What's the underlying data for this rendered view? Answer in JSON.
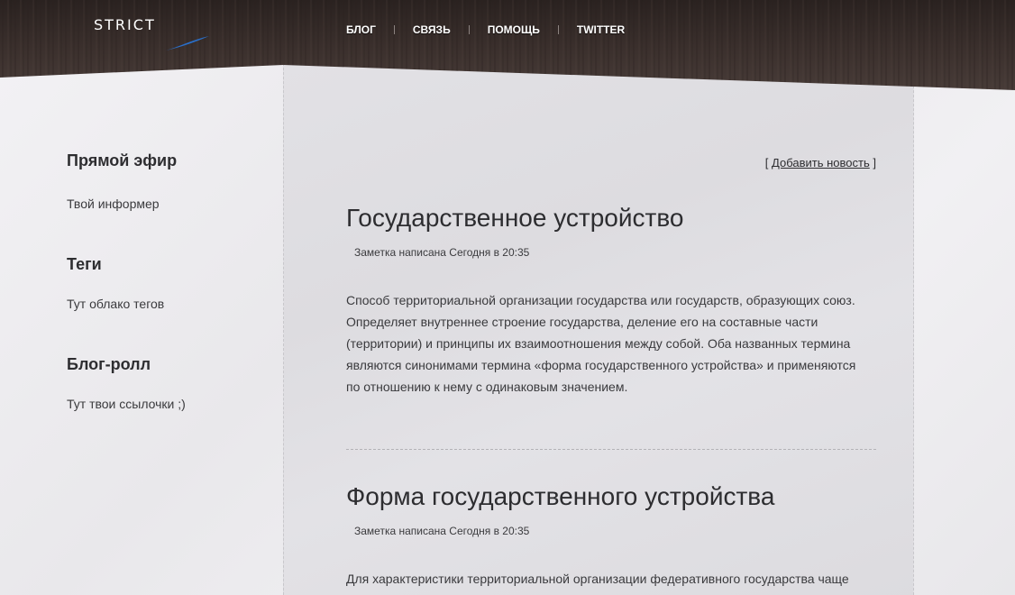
{
  "header": {
    "logo_text": "STRICT",
    "nav": [
      {
        "label": "БЛОГ"
      },
      {
        "label": "СВЯЗЬ"
      },
      {
        "label": "ПОМОЩЬ"
      },
      {
        "label": "TWITTER"
      }
    ]
  },
  "sidebar": {
    "sections": [
      {
        "title": "Прямой эфир",
        "text": "Твой информер"
      },
      {
        "title": "Теги",
        "text": "Тут облако тегов"
      },
      {
        "title": "Блог-ролл",
        "text": "Тут твои ссылочки ;)"
      }
    ]
  },
  "main": {
    "add_news": {
      "open": "[",
      "label": "Добавить новость",
      "close": "]"
    },
    "posts": [
      {
        "title": "Государственное устройство",
        "meta": "Заметка написана Сегодня в 20:35",
        "body": "Способ территориальной организации государства или государств, образующих союз. Определяет внутреннее строение государства, деление его на составные части (территории) и принципы их взаимоотношения между собой. Оба названных термина являются синонимами термина «форма государственного устройства» и применяются по отношению к нему с одинаковым значением."
      },
      {
        "title": "Форма государственного устройства",
        "meta": "Заметка написана Сегодня в 20:35",
        "body": "Для характеристики территориальной организации федеративного государства чаще"
      }
    ]
  },
  "colors": {
    "header_wood": "#3a2f2d",
    "logo_swoosh": "#2a6fc9",
    "text_dark": "#2d2d30"
  }
}
